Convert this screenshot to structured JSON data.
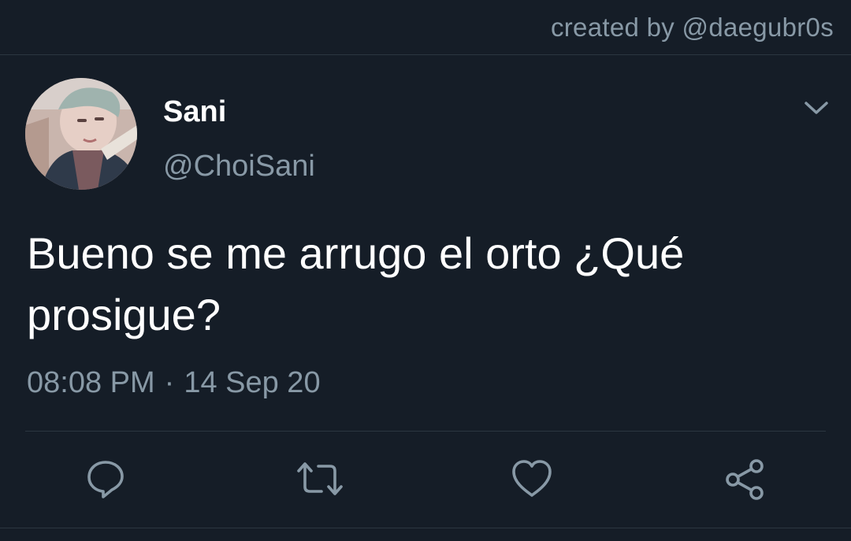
{
  "credit": "created by @daegubr0s",
  "tweet": {
    "display_name": "Sani",
    "handle": "@ChoiSani",
    "text": "Bueno se me arrugo el orto ¿Qué prosigue?",
    "time": "08:08 PM",
    "separator": "·",
    "date": "14 Sep 20"
  },
  "icons": {
    "menu": "chevron-down-icon",
    "reply": "reply-icon",
    "retweet": "retweet-icon",
    "like": "heart-icon",
    "share": "share-icon"
  },
  "colors": {
    "background": "#151d27",
    "secondary_text": "#8899a6",
    "primary_text": "#ffffff",
    "divider": "#2c3640"
  }
}
